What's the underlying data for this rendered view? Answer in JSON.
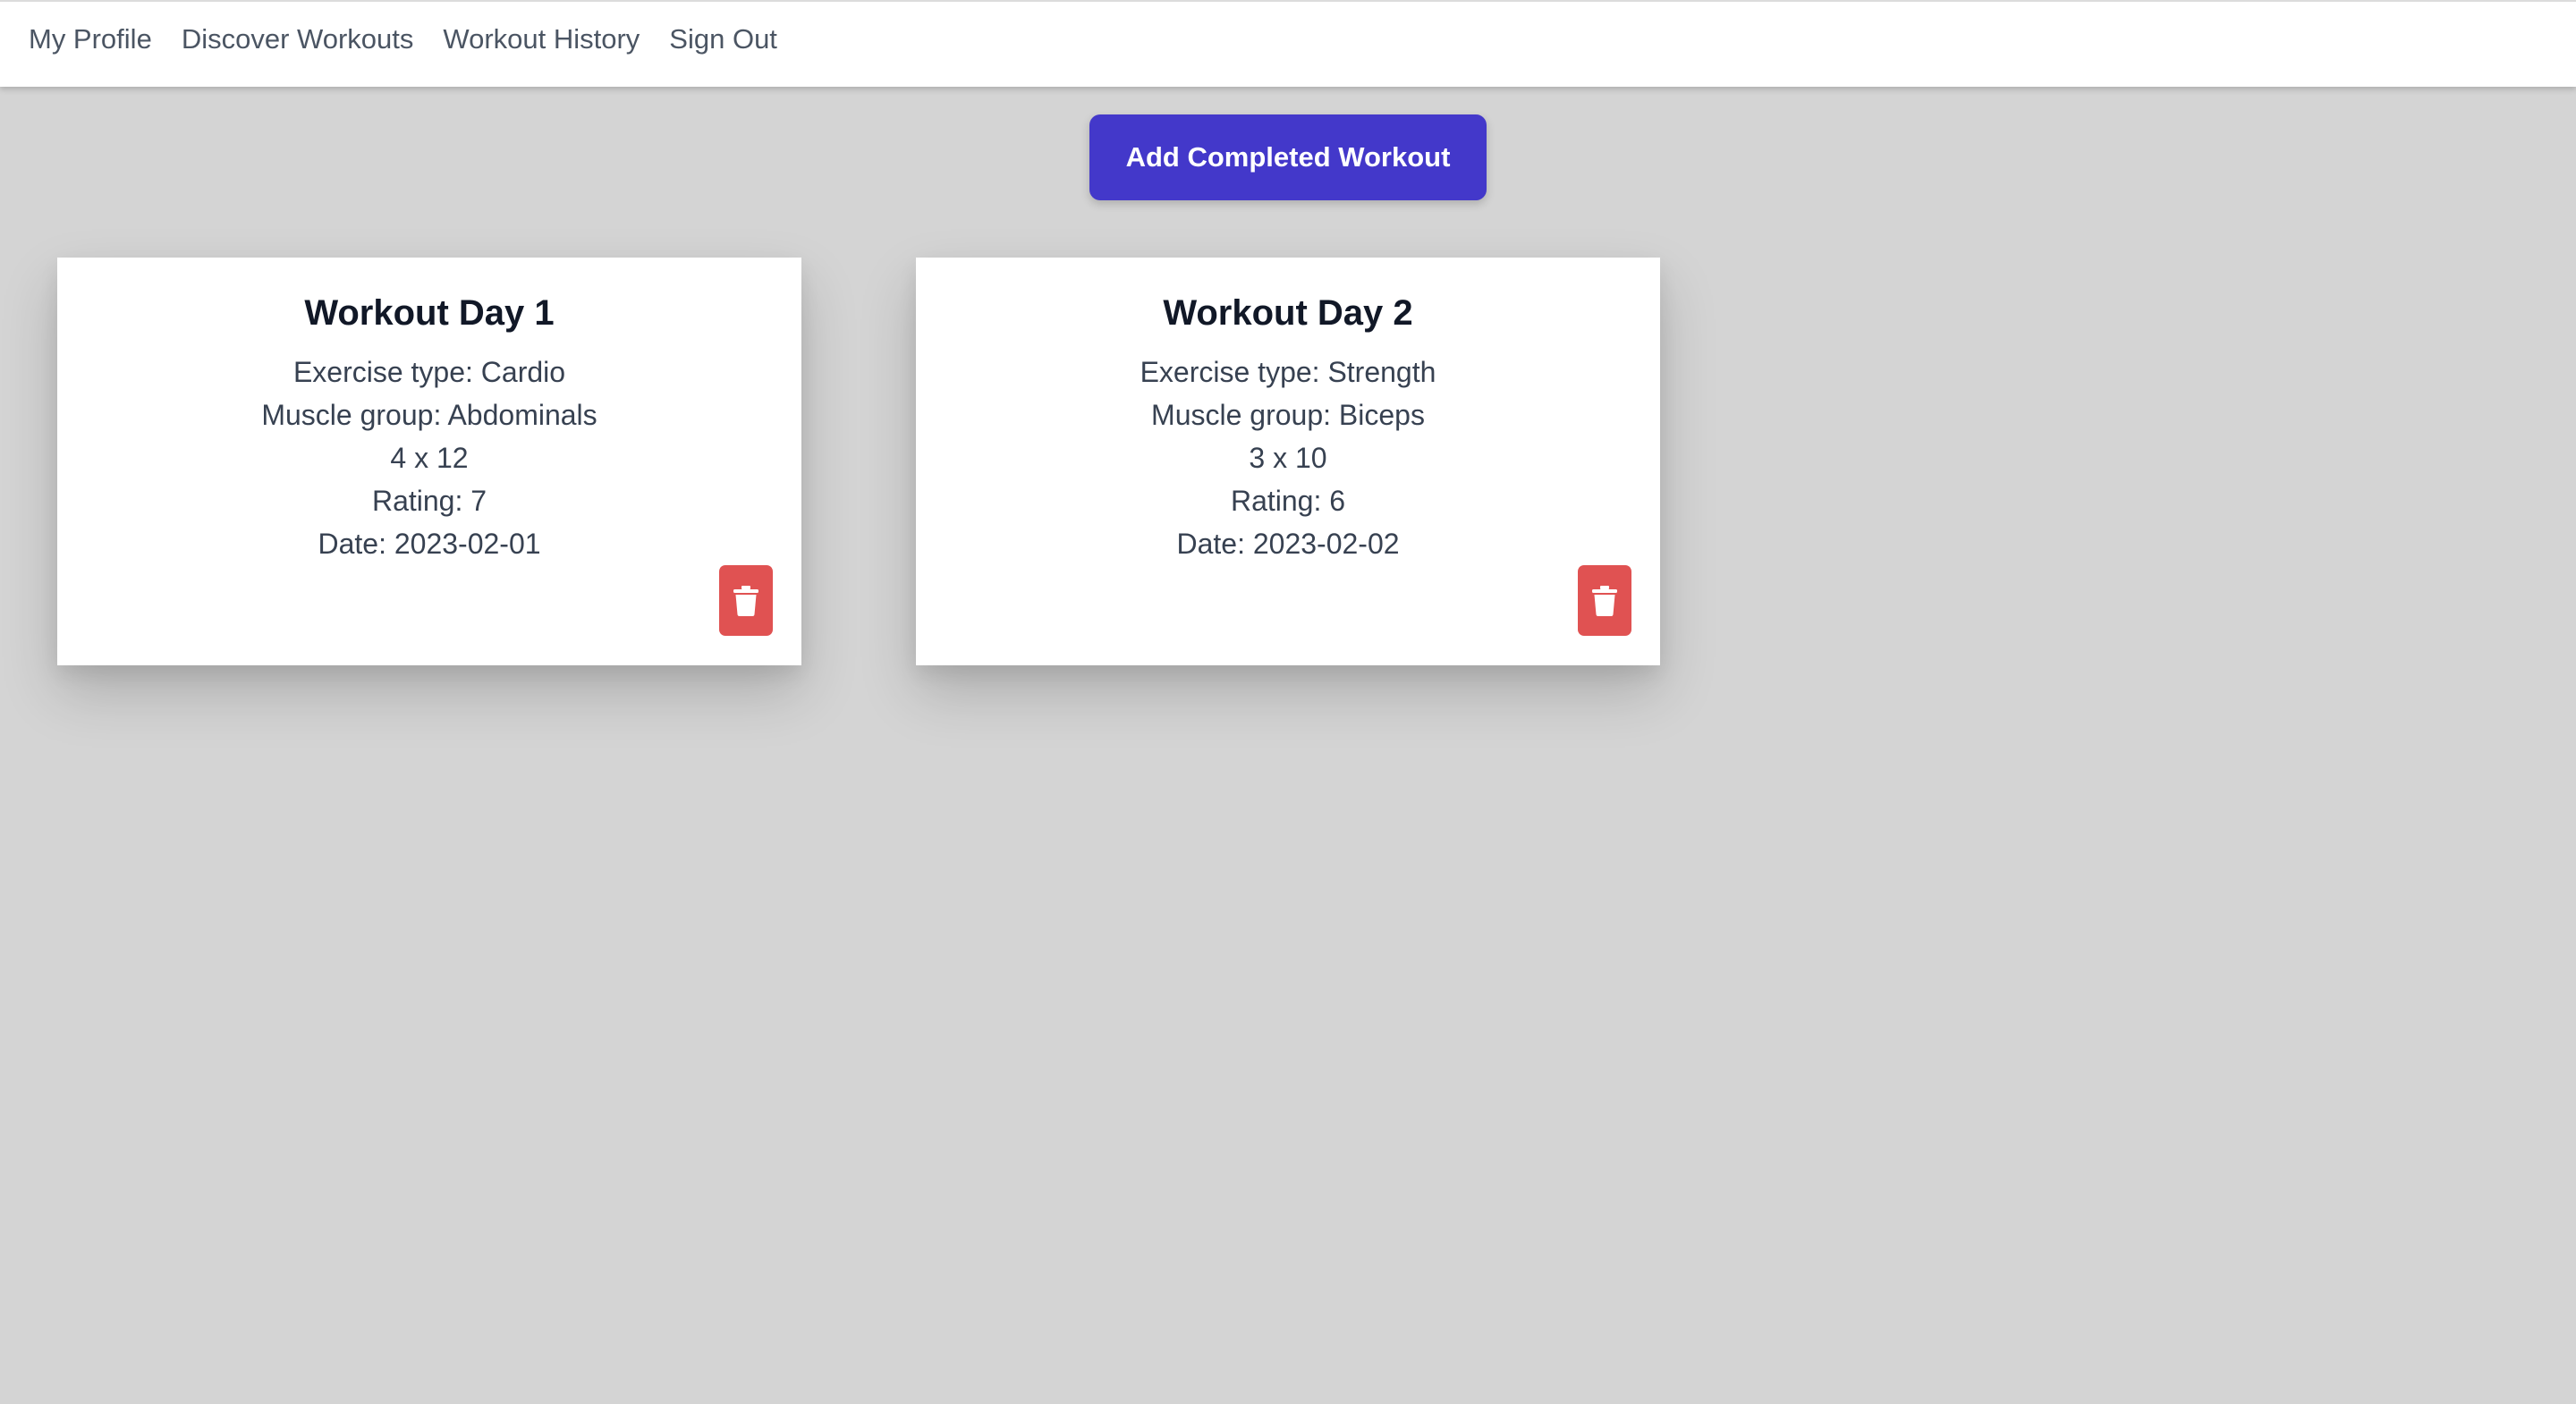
{
  "nav": {
    "items": [
      {
        "label": "My Profile"
      },
      {
        "label": "Discover Workouts"
      },
      {
        "label": "Workout History"
      },
      {
        "label": "Sign Out"
      }
    ]
  },
  "actions": {
    "add_label": "Add Completed Workout"
  },
  "workouts": [
    {
      "title": "Workout Day 1",
      "exercise_type": "Exercise type: Cardio",
      "muscle_group": "Muscle group: Abdominals",
      "sets_reps": "4 x 12",
      "rating": "Rating: 7",
      "date": "Date: 2023-02-01",
      "delete_icon": "trash-icon"
    },
    {
      "title": "Workout Day 2",
      "exercise_type": "Exercise type: Strength",
      "muscle_group": "Muscle group: Biceps",
      "sets_reps": "3 x 10",
      "rating": "Rating: 6",
      "date": "Date: 2023-02-02",
      "delete_icon": "trash-icon"
    }
  ],
  "colors": {
    "background": "#d4d4d4",
    "primary": "#4338ca",
    "danger": "#e05252",
    "card": "#ffffff"
  }
}
